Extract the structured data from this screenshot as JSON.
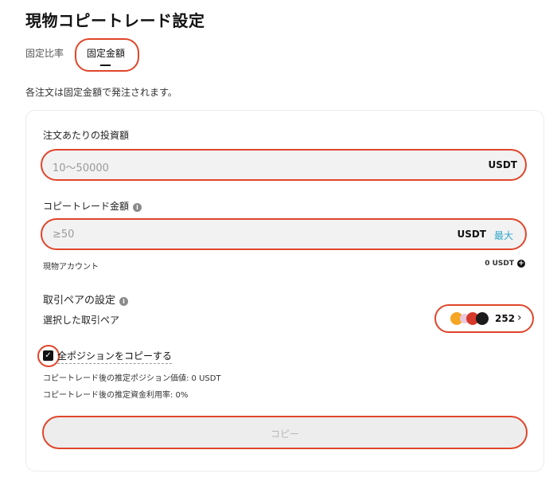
{
  "page": {
    "title": "現物コピートレード設定"
  },
  "tabs": {
    "ratio": "固定比率",
    "amount": "固定金額"
  },
  "description": "各注文は固定金額で発注されます。",
  "order_amount": {
    "label": "注文あたりの投資額",
    "placeholder": "10〜50000",
    "unit": "USDT"
  },
  "copy_amount": {
    "label": "コピートレード金額",
    "placeholder": "≥50",
    "unit": "USDT",
    "max_label": "最大",
    "account_label": "現物アカウント",
    "account_value": "0 USDT"
  },
  "pairs": {
    "label": "取引ペアの設定",
    "selected_label": "選択した取引ペア",
    "count": "252",
    "chevron": "›"
  },
  "copy_all": {
    "checked": true,
    "label": "全ポジションをコピーする",
    "position_value": "コピートレード後の推定ポジション価値: 0 USDT",
    "utilization": "コピートレード後の推定資金利用率: 0%"
  },
  "copy_button": {
    "label": "コピー"
  },
  "colors": {
    "highlight": "#e0452a",
    "accent": "#2fa6c9"
  }
}
